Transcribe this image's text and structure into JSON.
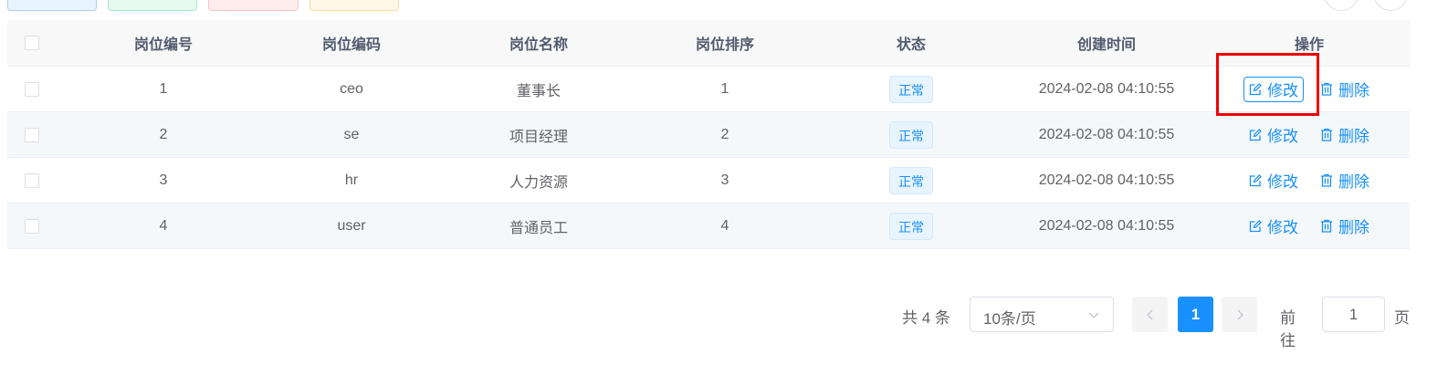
{
  "table": {
    "headers": [
      "岗位编号",
      "岗位编码",
      "岗位名称",
      "岗位排序",
      "状态",
      "创建时间",
      "操作"
    ],
    "rows": [
      {
        "id": "1",
        "code": "ceo",
        "name": "董事长",
        "sort": "1",
        "status": "正常",
        "created": "2024-02-08 04:10:55",
        "edit": "修改",
        "delete": "删除"
      },
      {
        "id": "2",
        "code": "se",
        "name": "项目经理",
        "sort": "2",
        "status": "正常",
        "created": "2024-02-08 04:10:55",
        "edit": "修改",
        "delete": "删除"
      },
      {
        "id": "3",
        "code": "hr",
        "name": "人力资源",
        "sort": "3",
        "status": "正常",
        "created": "2024-02-08 04:10:55",
        "edit": "修改",
        "delete": "删除"
      },
      {
        "id": "4",
        "code": "user",
        "name": "普通员工",
        "sort": "4",
        "status": "正常",
        "created": "2024-02-08 04:10:55",
        "edit": "修改",
        "delete": "删除"
      }
    ]
  },
  "pagination": {
    "total_text": "共 4 条",
    "page_size": "10条/页",
    "current_page": "1",
    "goto_label": "前往",
    "goto_value": "1",
    "goto_suffix": "页"
  },
  "colors": {
    "primary": "#1890ff",
    "highlight": "#ee0000",
    "tag_bg": "#e8f4ff"
  }
}
